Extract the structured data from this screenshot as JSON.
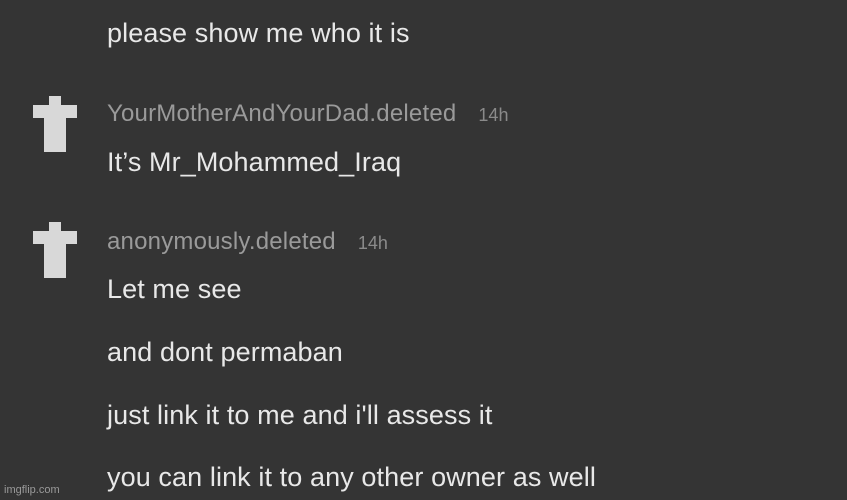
{
  "thread": {
    "previous_message": {
      "lines": [
        "please show me who it is"
      ]
    },
    "comments": [
      {
        "username": "YourMotherAndYourDad.deleted",
        "time": "14h",
        "avatar_icon": "deleted-user-avatar-icon",
        "lines": [
          "It’s Mr_Mohammed_Iraq"
        ]
      },
      {
        "username": "anonymously.deleted",
        "time": "14h",
        "avatar_icon": "deleted-user-avatar-icon",
        "lines": [
          "Let me see",
          "and dont permaban",
          "just link it to me and i'll assess it",
          "you can link it to any other owner as well"
        ]
      }
    ]
  },
  "watermark": "imgflip.com",
  "colors": {
    "background": "#343434",
    "message_text": "#e8e8e8",
    "username_text": "#9a9a9a",
    "timestamp_text": "#8a8a8a",
    "avatar": "#d8d8d8"
  }
}
